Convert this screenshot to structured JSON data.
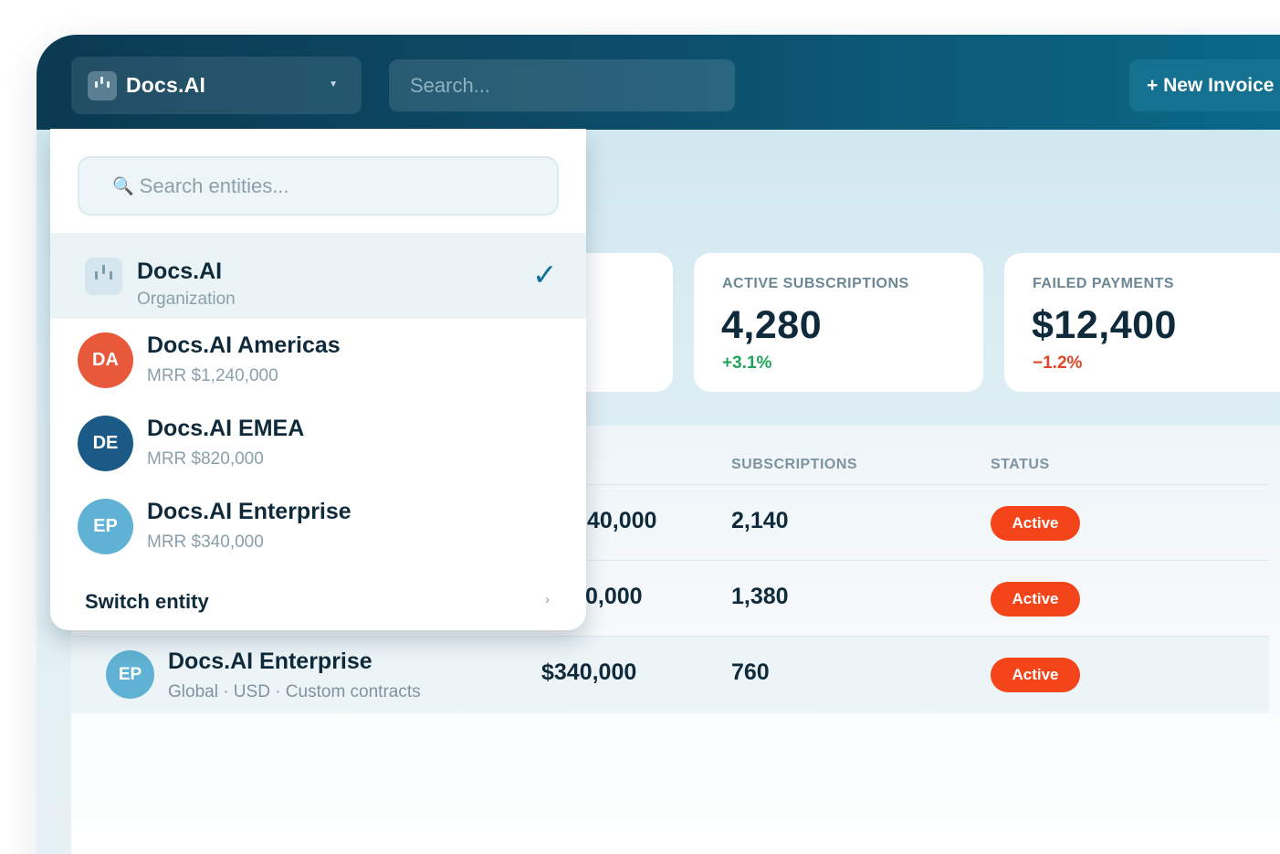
{
  "topbar": {
    "org_name": "Docs.AI",
    "search_placeholder": "Search...",
    "new_invoice_label": "+ New Invoice"
  },
  "metrics": [
    {
      "label": "ACTIVE SUBSCRIPTIONS",
      "value": "4,280",
      "delta": "+3.1%",
      "trend": "up"
    },
    {
      "label": "FAILED PAYMENTS",
      "value": "$12,400",
      "delta": "−1.2%",
      "trend": "down"
    }
  ],
  "table": {
    "headers": {
      "subscriptions": "SUBSCRIPTIONS",
      "status": "STATUS"
    },
    "rows": [
      {
        "mrr_partial": "40,000",
        "subscriptions": "2,140",
        "status": "Active"
      },
      {
        "mrr_partial": "0,000",
        "subscriptions": "1,380",
        "status": "Active"
      },
      {
        "initials": "EP",
        "name": "Docs.AI Enterprise",
        "details": "Global · USD · Custom contracts",
        "mrr": "$340,000",
        "subscriptions": "760",
        "status": "Active"
      }
    ]
  },
  "dropdown": {
    "search_placeholder": "Search entities...",
    "selected": {
      "name": "Docs.AI",
      "type": "Organization"
    },
    "entities": [
      {
        "initials": "DA",
        "name": "Docs.AI Americas",
        "mrr": "MRR $1,240,000",
        "color": "#e8583a"
      },
      {
        "initials": "DE",
        "name": "Docs.AI EMEA",
        "mrr": "MRR $820,000",
        "color": "#1b5a86"
      },
      {
        "initials": "EP",
        "name": "Docs.AI Enterprise",
        "mrr": "MRR $340,000",
        "color": "#5fb2d3"
      }
    ],
    "footer_label": "Switch entity"
  },
  "colors": {
    "accent": "#12739a",
    "status_active": "#f4441a",
    "positive": "#1fa55a",
    "negative": "#e2442a"
  },
  "icons": {
    "org_logo": "building-icon",
    "dropdown_caret": "chevron-down-icon",
    "search": "magnifier-icon",
    "selected": "check-icon",
    "footer": "chevron-right-icon"
  }
}
